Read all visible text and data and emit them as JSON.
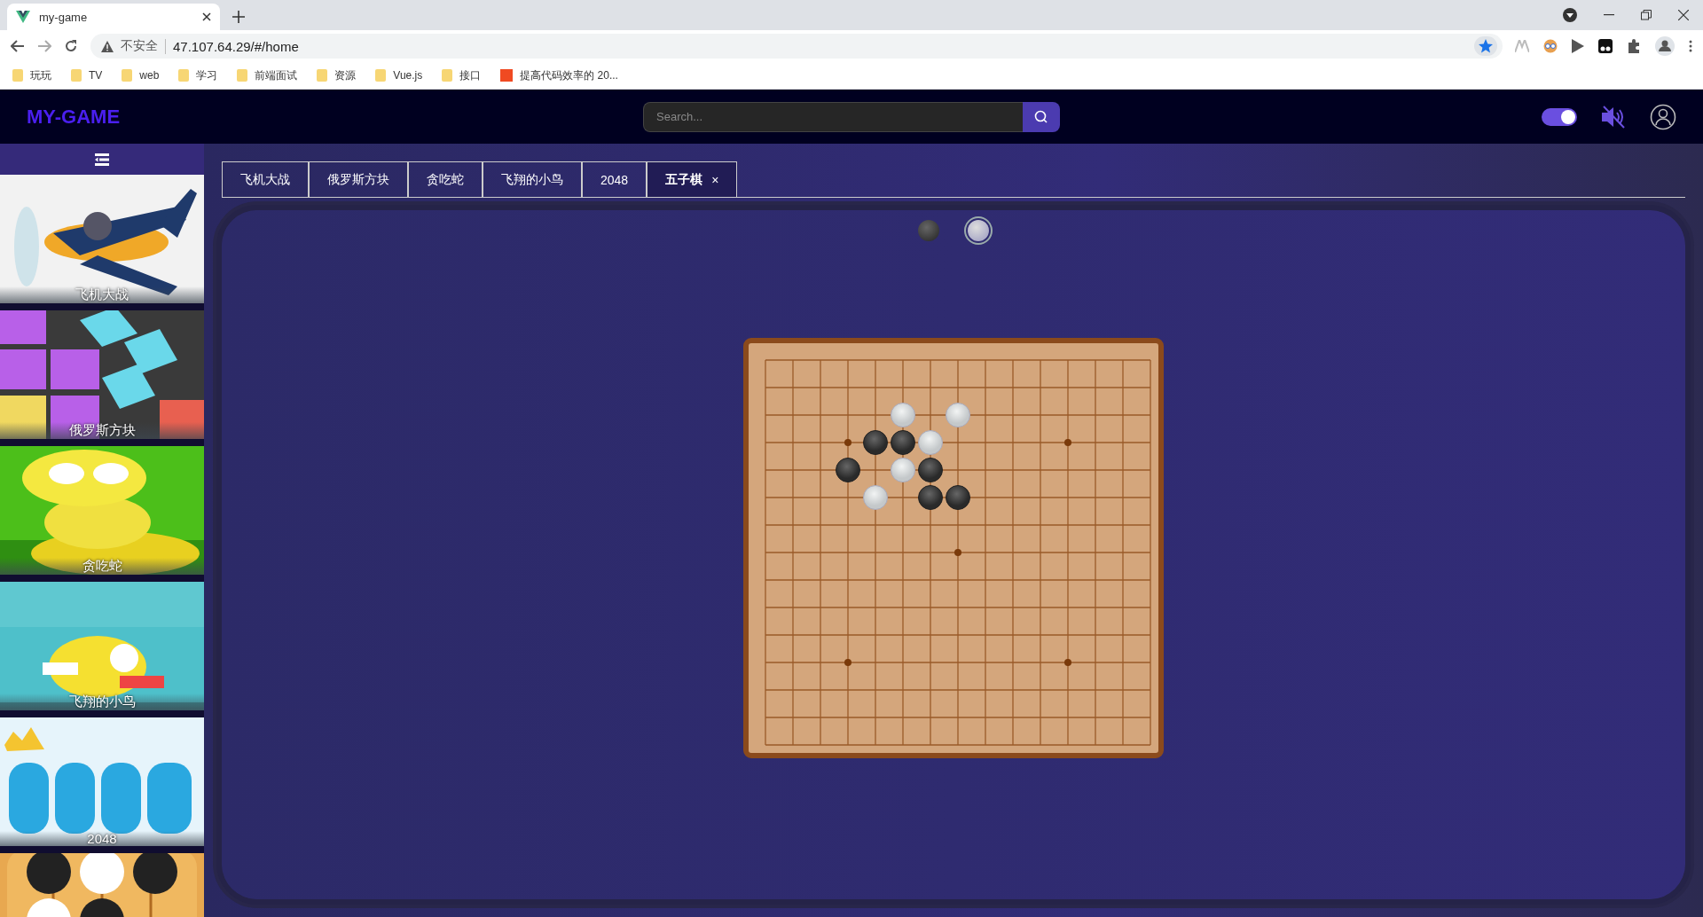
{
  "browser": {
    "tab_title": "my-game",
    "security": "不安全",
    "url": "47.107.64.29/#/home",
    "bookmarks": [
      {
        "label": "玩玩",
        "kind": "folder"
      },
      {
        "label": "TV",
        "kind": "folder"
      },
      {
        "label": "web",
        "kind": "folder"
      },
      {
        "label": "学习",
        "kind": "folder"
      },
      {
        "label": "前端面试",
        "kind": "folder"
      },
      {
        "label": "资源",
        "kind": "folder"
      },
      {
        "label": "Vue.js",
        "kind": "folder"
      },
      {
        "label": "接口",
        "kind": "folder"
      },
      {
        "label": "提高代码效率的 20...",
        "kind": "page"
      }
    ]
  },
  "header": {
    "logo": "MY-GAME",
    "search": {
      "placeholder": "Search..."
    },
    "theme_toggle": {
      "on": true
    },
    "sound": {
      "muted": true
    }
  },
  "sidebar": {
    "games": [
      {
        "title": "飞机大战",
        "kind": "picture"
      },
      {
        "title": "俄罗斯方块",
        "kind": "picture"
      },
      {
        "title": "贪吃蛇",
        "kind": "picture"
      },
      {
        "title": "飞翔的小鸟",
        "kind": "picture"
      },
      {
        "title": "2048",
        "kind": "picture"
      },
      {
        "kind": "picture"
      }
    ]
  },
  "tabs": [
    {
      "label": "飞机大战",
      "selected": false,
      "closable": false
    },
    {
      "label": "俄罗斯方块",
      "selected": false,
      "closable": false
    },
    {
      "label": "贪吃蛇",
      "selected": false,
      "closable": false
    },
    {
      "label": "飞翔的小鸟",
      "selected": false,
      "closable": false
    },
    {
      "label": "2048",
      "selected": false,
      "closable": false
    },
    {
      "label": "五子棋",
      "selected": true,
      "closable": true,
      "close": "×"
    }
  ],
  "players": [
    {
      "kind": "black",
      "selected": false
    },
    {
      "kind": "white",
      "selected": true
    }
  ],
  "board": {
    "rows": [
      [
        {
          "kind": "empty"
        },
        {
          "kind": "empty"
        },
        {
          "kind": "empty"
        },
        {
          "kind": "empty"
        },
        {
          "kind": "empty"
        },
        {
          "kind": "empty"
        },
        {
          "kind": "empty"
        },
        {
          "kind": "empty"
        },
        {
          "kind": "empty"
        },
        {
          "kind": "empty"
        },
        {
          "kind": "empty"
        },
        {
          "kind": "empty"
        },
        {
          "kind": "empty"
        },
        {
          "kind": "empty"
        },
        {
          "kind": "empty"
        }
      ],
      [
        {
          "kind": "empty"
        },
        {
          "kind": "empty"
        },
        {
          "kind": "empty"
        },
        {
          "kind": "empty"
        },
        {
          "kind": "empty"
        },
        {
          "kind": "empty"
        },
        {
          "kind": "empty"
        },
        {
          "kind": "empty"
        },
        {
          "kind": "empty"
        },
        {
          "kind": "empty"
        },
        {
          "kind": "empty"
        },
        {
          "kind": "empty"
        },
        {
          "kind": "empty"
        },
        {
          "kind": "empty"
        },
        {
          "kind": "empty"
        }
      ],
      [
        {
          "kind": "empty"
        },
        {
          "kind": "empty"
        },
        {
          "kind": "empty"
        },
        {
          "kind": "empty"
        },
        {
          "kind": "empty"
        },
        {
          "kind": "white"
        },
        {
          "kind": "empty"
        },
        {
          "kind": "white"
        },
        {
          "kind": "empty"
        },
        {
          "kind": "empty"
        },
        {
          "kind": "empty"
        },
        {
          "kind": "empty"
        },
        {
          "kind": "empty"
        },
        {
          "kind": "empty"
        },
        {
          "kind": "empty"
        }
      ],
      [
        {
          "kind": "empty"
        },
        {
          "kind": "empty"
        },
        {
          "kind": "empty"
        },
        {
          "kind": "empty"
        },
        {
          "kind": "black"
        },
        {
          "kind": "black"
        },
        {
          "kind": "white"
        },
        {
          "kind": "empty"
        },
        {
          "kind": "empty"
        },
        {
          "kind": "empty"
        },
        {
          "kind": "empty"
        },
        {
          "kind": "empty"
        },
        {
          "kind": "empty"
        },
        {
          "kind": "empty"
        },
        {
          "kind": "empty"
        }
      ],
      [
        {
          "kind": "empty"
        },
        {
          "kind": "empty"
        },
        {
          "kind": "empty"
        },
        {
          "kind": "black"
        },
        {
          "kind": "empty"
        },
        {
          "kind": "white"
        },
        {
          "kind": "black"
        },
        {
          "kind": "empty"
        },
        {
          "kind": "empty"
        },
        {
          "kind": "empty"
        },
        {
          "kind": "empty"
        },
        {
          "kind": "empty"
        },
        {
          "kind": "empty"
        },
        {
          "kind": "empty"
        },
        {
          "kind": "empty"
        }
      ],
      [
        {
          "kind": "empty"
        },
        {
          "kind": "empty"
        },
        {
          "kind": "empty"
        },
        {
          "kind": "empty"
        },
        {
          "kind": "white"
        },
        {
          "kind": "empty"
        },
        {
          "kind": "black"
        },
        {
          "kind": "black"
        },
        {
          "kind": "empty"
        },
        {
          "kind": "empty"
        },
        {
          "kind": "empty"
        },
        {
          "kind": "empty"
        },
        {
          "kind": "empty"
        },
        {
          "kind": "empty"
        },
        {
          "kind": "empty"
        }
      ],
      [
        {
          "kind": "empty"
        },
        {
          "kind": "empty"
        },
        {
          "kind": "empty"
        },
        {
          "kind": "empty"
        },
        {
          "kind": "empty"
        },
        {
          "kind": "empty"
        },
        {
          "kind": "empty"
        },
        {
          "kind": "empty"
        },
        {
          "kind": "empty"
        },
        {
          "kind": "empty"
        },
        {
          "kind": "empty"
        },
        {
          "kind": "empty"
        },
        {
          "kind": "empty"
        },
        {
          "kind": "empty"
        },
        {
          "kind": "empty"
        }
      ],
      [
        {
          "kind": "empty"
        },
        {
          "kind": "empty"
        },
        {
          "kind": "empty"
        },
        {
          "kind": "empty"
        },
        {
          "kind": "empty"
        },
        {
          "kind": "empty"
        },
        {
          "kind": "empty"
        },
        {
          "kind": "empty"
        },
        {
          "kind": "empty"
        },
        {
          "kind": "empty"
        },
        {
          "kind": "empty"
        },
        {
          "kind": "empty"
        },
        {
          "kind": "empty"
        },
        {
          "kind": "empty"
        },
        {
          "kind": "empty"
        }
      ],
      [
        {
          "kind": "empty"
        },
        {
          "kind": "empty"
        },
        {
          "kind": "empty"
        },
        {
          "kind": "empty"
        },
        {
          "kind": "empty"
        },
        {
          "kind": "empty"
        },
        {
          "kind": "empty"
        },
        {
          "kind": "empty"
        },
        {
          "kind": "empty"
        },
        {
          "kind": "empty"
        },
        {
          "kind": "empty"
        },
        {
          "kind": "empty"
        },
        {
          "kind": "empty"
        },
        {
          "kind": "empty"
        },
        {
          "kind": "empty"
        }
      ],
      [
        {
          "kind": "empty"
        },
        {
          "kind": "empty"
        },
        {
          "kind": "empty"
        },
        {
          "kind": "empty"
        },
        {
          "kind": "empty"
        },
        {
          "kind": "empty"
        },
        {
          "kind": "empty"
        },
        {
          "kind": "empty"
        },
        {
          "kind": "empty"
        },
        {
          "kind": "empty"
        },
        {
          "kind": "empty"
        },
        {
          "kind": "empty"
        },
        {
          "kind": "empty"
        },
        {
          "kind": "empty"
        },
        {
          "kind": "empty"
        }
      ],
      [
        {
          "kind": "empty"
        },
        {
          "kind": "empty"
        },
        {
          "kind": "empty"
        },
        {
          "kind": "empty"
        },
        {
          "kind": "empty"
        },
        {
          "kind": "empty"
        },
        {
          "kind": "empty"
        },
        {
          "kind": "empty"
        },
        {
          "kind": "empty"
        },
        {
          "kind": "empty"
        },
        {
          "kind": "empty"
        },
        {
          "kind": "empty"
        },
        {
          "kind": "empty"
        },
        {
          "kind": "empty"
        },
        {
          "kind": "empty"
        }
      ],
      [
        {
          "kind": "empty"
        },
        {
          "kind": "empty"
        },
        {
          "kind": "empty"
        },
        {
          "kind": "empty"
        },
        {
          "kind": "empty"
        },
        {
          "kind": "empty"
        },
        {
          "kind": "empty"
        },
        {
          "kind": "empty"
        },
        {
          "kind": "empty"
        },
        {
          "kind": "empty"
        },
        {
          "kind": "empty"
        },
        {
          "kind": "empty"
        },
        {
          "kind": "empty"
        },
        {
          "kind": "empty"
        },
        {
          "kind": "empty"
        }
      ],
      [
        {
          "kind": "empty"
        },
        {
          "kind": "empty"
        },
        {
          "kind": "empty"
        },
        {
          "kind": "empty"
        },
        {
          "kind": "empty"
        },
        {
          "kind": "empty"
        },
        {
          "kind": "empty"
        },
        {
          "kind": "empty"
        },
        {
          "kind": "empty"
        },
        {
          "kind": "empty"
        },
        {
          "kind": "empty"
        },
        {
          "kind": "empty"
        },
        {
          "kind": "empty"
        },
        {
          "kind": "empty"
        },
        {
          "kind": "empty"
        }
      ],
      [
        {
          "kind": "empty"
        },
        {
          "kind": "empty"
        },
        {
          "kind": "empty"
        },
        {
          "kind": "empty"
        },
        {
          "kind": "empty"
        },
        {
          "kind": "empty"
        },
        {
          "kind": "empty"
        },
        {
          "kind": "empty"
        },
        {
          "kind": "empty"
        },
        {
          "kind": "empty"
        },
        {
          "kind": "empty"
        },
        {
          "kind": "empty"
        },
        {
          "kind": "empty"
        },
        {
          "kind": "empty"
        },
        {
          "kind": "empty"
        }
      ],
      [
        {
          "kind": "empty"
        },
        {
          "kind": "empty"
        },
        {
          "kind": "empty"
        },
        {
          "kind": "empty"
        },
        {
          "kind": "empty"
        },
        {
          "kind": "empty"
        },
        {
          "kind": "empty"
        },
        {
          "kind": "empty"
        },
        {
          "kind": "empty"
        },
        {
          "kind": "empty"
        },
        {
          "kind": "empty"
        },
        {
          "kind": "empty"
        },
        {
          "kind": "empty"
        },
        {
          "kind": "empty"
        },
        {
          "kind": "empty"
        }
      ]
    ]
  }
}
